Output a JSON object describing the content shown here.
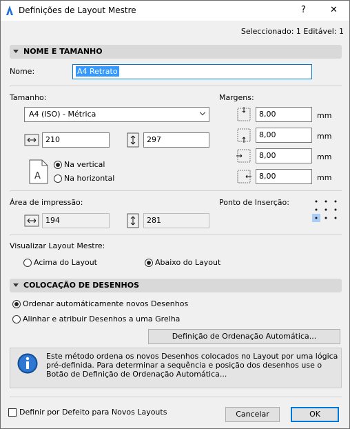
{
  "window": {
    "title": "Definições de Layout Mestre",
    "help": "?",
    "close": "✕"
  },
  "status": "Seleccionado: 1 Editável: 1",
  "section1": {
    "title": "NOME E TAMANHO"
  },
  "name": {
    "label": "Nome:",
    "value": "A4 Retrato"
  },
  "size": {
    "label": "Tamanho:",
    "selected": "A4 (ISO) - Métrica",
    "width": "210",
    "height": "297",
    "orientation_vertical": "Na vertical",
    "orientation_horizontal": "Na horizontal"
  },
  "margins": {
    "label": "Margens:",
    "values": [
      "8,00",
      "8,00",
      "8,00",
      "8,00"
    ],
    "unit": "mm"
  },
  "print_area": {
    "label": "Área de impressão:",
    "width": "194",
    "height": "281"
  },
  "insertion": {
    "label": "Ponto de Inserção:"
  },
  "view_master": {
    "label": "Visualizar Layout Mestre:",
    "above": "Acima do Layout",
    "below": "Abaixo do Layout"
  },
  "section2": {
    "title": "COLOCAÇÃO DE DESENHOS"
  },
  "placement": {
    "auto": "Ordenar automáticamente novos Desenhos",
    "grid": "Alinhar e atribuir Desenhos a uma Grelha",
    "button": "Definição de Ordenação Automática..."
  },
  "info": {
    "text": "Este método ordena os novos Desenhos colocados no Layout por uma lógica pré-definida. Para determinar a sequência e posição dos desenhos use o Botão de Definição de Ordenação Automática..."
  },
  "footer": {
    "default_check": "Definir por Defeito para Novos Layouts",
    "cancel": "Cancelar",
    "ok": "OK"
  },
  "colors": {
    "accent": "#0078d7",
    "selection": "#3399ff",
    "info_icon": "#1a5fb4"
  }
}
